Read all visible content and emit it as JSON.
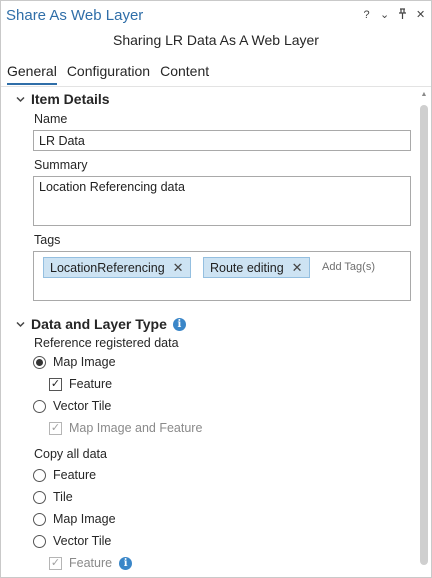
{
  "window": {
    "title": "Share As Web Layer",
    "controls": [
      "?",
      "⌄",
      "⊥",
      "✕"
    ]
  },
  "subtitle": "Sharing LR Data As A Web Layer",
  "tabs": [
    {
      "label": "General",
      "active": true
    },
    {
      "label": "Configuration",
      "active": false
    },
    {
      "label": "Content",
      "active": false
    }
  ],
  "item_details": {
    "heading": "Item Details",
    "name_label": "Name",
    "name_value": "LR Data",
    "summary_label": "Summary",
    "summary_value": "Location Referencing data",
    "tags_label": "Tags",
    "tags": [
      "LocationReferencing",
      "Route editing"
    ],
    "add_tag_placeholder": "Add Tag(s)"
  },
  "data_layer_type": {
    "heading": "Data and Layer Type",
    "reference_label": "Reference registered data",
    "reference_options": {
      "map_image": "Map Image",
      "feature": "Feature",
      "vector_tile": "Vector Tile",
      "map_image_and_feature": "Map Image and Feature"
    },
    "copy_label": "Copy all data",
    "copy_options": {
      "feature": "Feature",
      "tile": "Tile",
      "map_image": "Map Image",
      "vector_tile": "Vector Tile",
      "vt_feature": "Feature"
    }
  },
  "colors": {
    "accent": "#2f6ea8",
    "tag_bg": "#cde3f3",
    "info": "#3a86c8"
  }
}
